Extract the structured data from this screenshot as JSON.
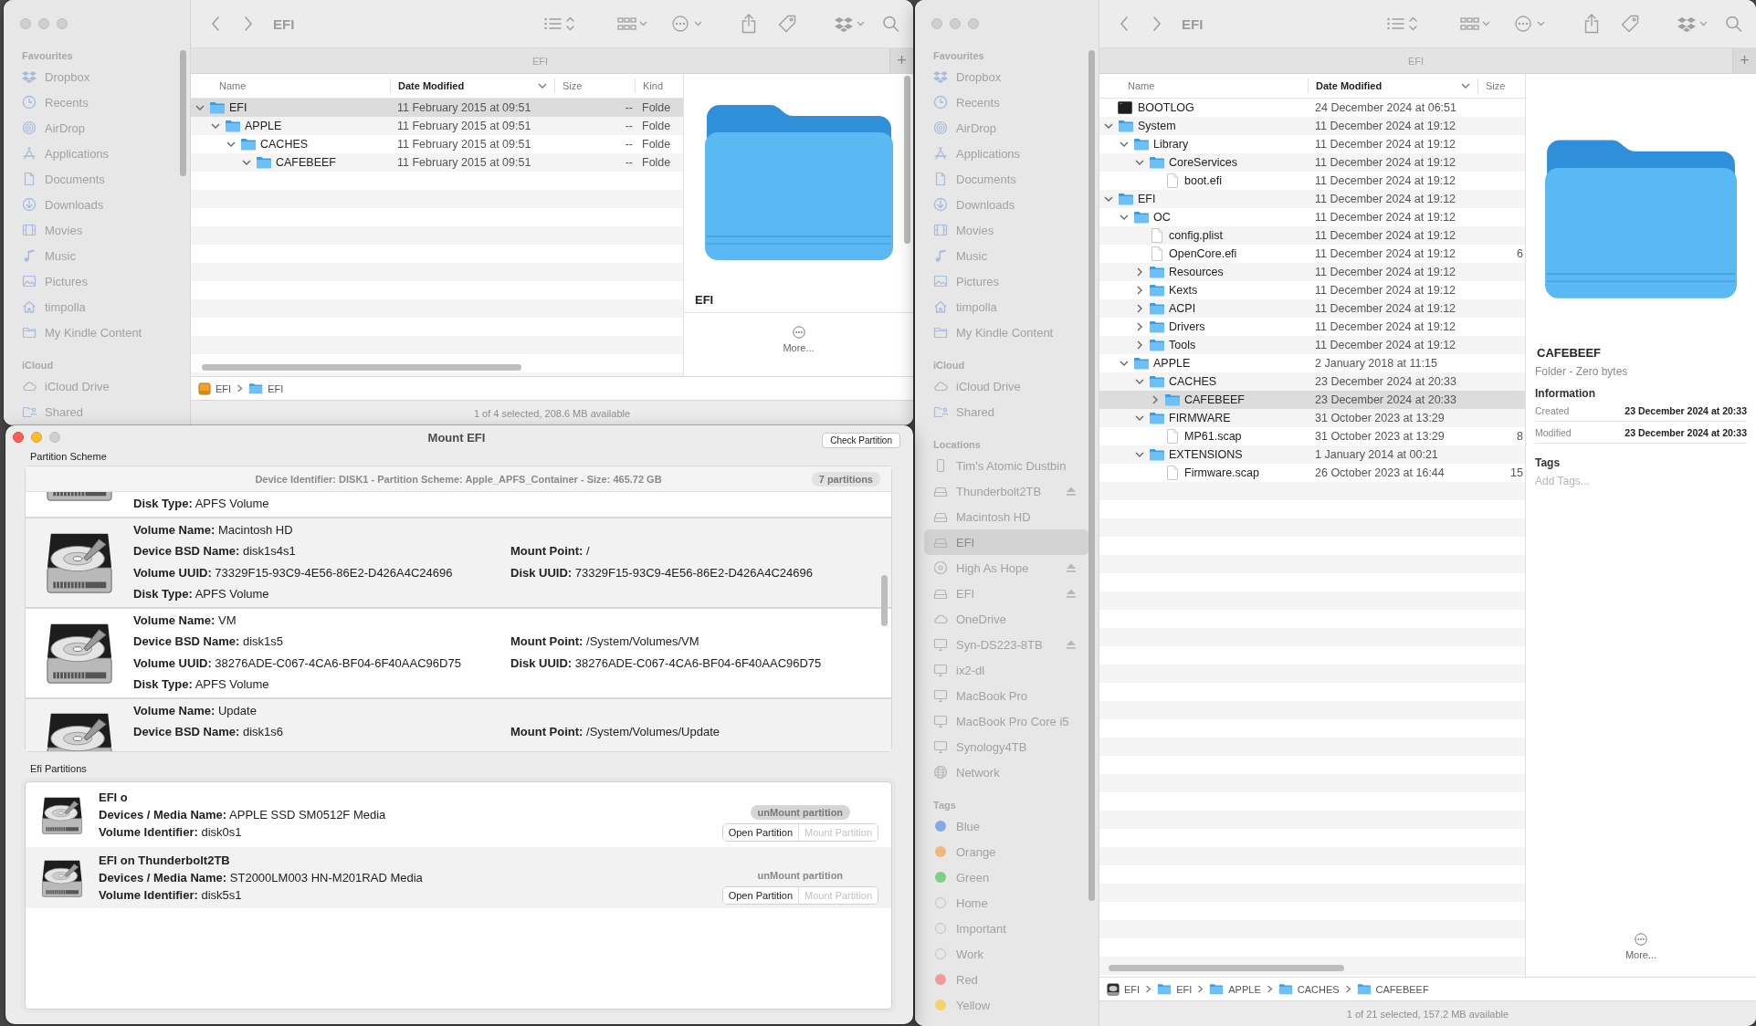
{
  "finder_windows": [
    {
      "active": false,
      "title": "EFI",
      "tab": "EFI",
      "new_tab": "+",
      "sidebar": [
        {
          "heading": "Favourites",
          "items": [
            {
              "label": "Dropbox",
              "kind": "dropbox",
              "selected": false
            },
            {
              "label": "Recents",
              "kind": "clock",
              "selected": false
            },
            {
              "label": "AirDrop",
              "kind": "airdrop",
              "selected": false
            },
            {
              "label": "Applications",
              "kind": "apps",
              "selected": false
            },
            {
              "label": "Documents",
              "kind": "document",
              "selected": false
            },
            {
              "label": "Downloads",
              "kind": "download",
              "selected": false
            },
            {
              "label": "Movies",
              "kind": "film",
              "selected": false
            },
            {
              "label": "Music",
              "kind": "music",
              "selected": false
            },
            {
              "label": "Pictures",
              "kind": "picture",
              "selected": false
            },
            {
              "label": "timpolla",
              "kind": "home",
              "selected": false
            },
            {
              "label": "My Kindle Content",
              "kind": "folder",
              "selected": false
            }
          ]
        },
        {
          "heading": "iCloud",
          "items": [
            {
              "label": "iCloud Drive",
              "kind": "cloud",
              "selected": false
            },
            {
              "label": "Shared",
              "kind": "shared",
              "selected": false
            }
          ]
        }
      ],
      "columns": [
        {
          "label": "Name",
          "sorted": false
        },
        {
          "label": "Date Modified",
          "sorted": true
        },
        {
          "label": "Size",
          "sorted": false
        },
        {
          "label": "Kind",
          "sorted": false
        }
      ],
      "rows": [
        {
          "name": "EFI",
          "kind": "folder",
          "expanded": true,
          "selected": true,
          "date_modified": "11 February 2015 at 09:51",
          "size": "--",
          "kind_label": "Folde",
          "children": [
            {
              "name": "APPLE",
              "kind": "folder",
              "expanded": true,
              "selected": false,
              "date_modified": "11 February 2015 at 09:51",
              "size": "--",
              "kind_label": "Folde",
              "children": [
                {
                  "name": "CACHES",
                  "kind": "folder",
                  "expanded": true,
                  "selected": false,
                  "date_modified": "11 February 2015 at 09:51",
                  "size": "--",
                  "kind_label": "Folde",
                  "children": [
                    {
                      "name": "CAFEBEEF",
                      "kind": "folder",
                      "expanded": true,
                      "selected": false,
                      "date_modified": "11 February 2015 at 09:51",
                      "size": "--",
                      "kind_label": "Folde"
                    }
                  ]
                }
              ]
            }
          ]
        }
      ],
      "path": [
        {
          "label": "EFI",
          "kind": "external_disk"
        },
        {
          "label": "EFI",
          "kind": "folder"
        }
      ],
      "status": "1 of 4 selected, 208.6 MB available",
      "preview": {
        "name": "EFI",
        "more": "More..."
      }
    },
    {
      "active": false,
      "title": "EFI",
      "tab": "EFI",
      "new_tab": "+",
      "sidebar": [
        {
          "heading": "Favourites",
          "items": [
            {
              "label": "Dropbox",
              "kind": "dropbox",
              "selected": false
            },
            {
              "label": "Recents",
              "kind": "clock",
              "selected": false
            },
            {
              "label": "AirDrop",
              "kind": "airdrop",
              "selected": false
            },
            {
              "label": "Applications",
              "kind": "apps",
              "selected": false
            },
            {
              "label": "Documents",
              "kind": "document",
              "selected": false
            },
            {
              "label": "Downloads",
              "kind": "download",
              "selected": false
            },
            {
              "label": "Movies",
              "kind": "film",
              "selected": false
            },
            {
              "label": "Music",
              "kind": "music",
              "selected": false
            },
            {
              "label": "Pictures",
              "kind": "picture",
              "selected": false
            },
            {
              "label": "timpolla",
              "kind": "home",
              "selected": false
            },
            {
              "label": "My Kindle Content",
              "kind": "folder",
              "selected": false
            }
          ]
        },
        {
          "heading": "iCloud",
          "items": [
            {
              "label": "iCloud Drive",
              "kind": "cloud",
              "selected": false
            },
            {
              "label": "Shared",
              "kind": "shared",
              "selected": false
            }
          ]
        },
        {
          "heading": "Locations",
          "items": [
            {
              "label": "Tim's Atomic Dustbin",
              "kind": "phone",
              "selected": false,
              "eject": false
            },
            {
              "label": "Thunderbolt2TB",
              "kind": "drive",
              "selected": false,
              "eject": true
            },
            {
              "label": "Macintosh HD",
              "kind": "drive",
              "selected": false,
              "eject": false
            },
            {
              "label": "EFI",
              "kind": "drive",
              "selected": true,
              "eject": false
            },
            {
              "label": "High As Hope",
              "kind": "disc",
              "selected": false,
              "eject": true
            },
            {
              "label": "EFI",
              "kind": "drive",
              "selected": false,
              "eject": true
            },
            {
              "label": "OneDrive",
              "kind": "cloud",
              "selected": false,
              "eject": false
            },
            {
              "label": "Syn-DS223-8TB",
              "kind": "monitor",
              "selected": false,
              "eject": true
            },
            {
              "label": "ix2-dl",
              "kind": "monitor",
              "selected": false,
              "eject": false
            },
            {
              "label": "MacBook Pro",
              "kind": "monitor",
              "selected": false,
              "eject": false
            },
            {
              "label": "MacBook Pro Core i5",
              "kind": "monitor",
              "selected": false,
              "eject": false
            },
            {
              "label": "Synology4TB",
              "kind": "monitor",
              "selected": false,
              "eject": false
            },
            {
              "label": "Network",
              "kind": "globe",
              "selected": false,
              "eject": false
            }
          ]
        },
        {
          "heading": "Tags",
          "items": [
            {
              "label": "Blue",
              "kind": "tag",
              "selected": false,
              "color": "#82aae6"
            },
            {
              "label": "Orange",
              "kind": "tag",
              "selected": false,
              "color": "#f0b77a"
            },
            {
              "label": "Green",
              "kind": "tag",
              "selected": false,
              "color": "#7ccf86"
            },
            {
              "label": "Home",
              "kind": "tag",
              "selected": false
            },
            {
              "label": "Important",
              "kind": "tag",
              "selected": false
            },
            {
              "label": "Work",
              "kind": "tag",
              "selected": false
            },
            {
              "label": "Red",
              "kind": "tag",
              "selected": false,
              "color": "#f09a9a"
            },
            {
              "label": "Yellow",
              "kind": "tag",
              "selected": false,
              "color": "#f3d36a"
            }
          ]
        }
      ],
      "columns": [
        {
          "label": "Name",
          "sorted": false
        },
        {
          "label": "Date Modified",
          "sorted": true
        },
        {
          "label": "Size",
          "sorted": false
        }
      ],
      "rows": [
        {
          "name": "BOOTLOG",
          "kind": "log",
          "selected": false,
          "date_modified": "24 December 2024 at 06:51"
        },
        {
          "name": "System",
          "kind": "folder",
          "expanded": true,
          "selected": false,
          "date_modified": "11 December 2024 at 19:12",
          "children": [
            {
              "name": "Library",
              "kind": "folder",
              "expanded": true,
              "selected": false,
              "date_modified": "11 December 2024 at 19:12",
              "children": [
                {
                  "name": "CoreServices",
                  "kind": "folder",
                  "expanded": true,
                  "selected": false,
                  "date_modified": "11 December 2024 at 19:12",
                  "children": [
                    {
                      "name": "boot.efi",
                      "kind": "file",
                      "selected": false,
                      "date_modified": "11 December 2024 at 19:12"
                    }
                  ]
                }
              ]
            }
          ]
        },
        {
          "name": "EFI",
          "kind": "folder",
          "expanded": true,
          "selected": false,
          "date_modified": "11 December 2024 at 19:12",
          "children": [
            {
              "name": "OC",
              "kind": "folder",
              "expanded": true,
              "selected": false,
              "date_modified": "11 December 2024 at 19:12",
              "children": [
                {
                  "name": "config.plist",
                  "kind": "file",
                  "selected": false,
                  "date_modified": "11 December 2024 at 19:12"
                },
                {
                  "name": "OpenCore.efi",
                  "kind": "file",
                  "selected": false,
                  "date_modified": "11 December 2024 at 19:12",
                  "size": "6"
                },
                {
                  "name": "Resources",
                  "kind": "folder",
                  "expanded": false,
                  "selected": false,
                  "date_modified": "11 December 2024 at 19:12"
                },
                {
                  "name": "Kexts",
                  "kind": "folder",
                  "expanded": false,
                  "selected": false,
                  "date_modified": "11 December 2024 at 19:12"
                },
                {
                  "name": "ACPI",
                  "kind": "folder",
                  "expanded": false,
                  "selected": false,
                  "date_modified": "11 December 2024 at 19:12"
                },
                {
                  "name": "Drivers",
                  "kind": "folder",
                  "expanded": false,
                  "selected": false,
                  "date_modified": "11 December 2024 at 19:12"
                },
                {
                  "name": "Tools",
                  "kind": "folder",
                  "expanded": false,
                  "selected": false,
                  "date_modified": "11 December 2024 at 19:12"
                }
              ]
            },
            {
              "name": "APPLE",
              "kind": "folder",
              "expanded": true,
              "selected": false,
              "date_modified": "2 January 2018 at 11:15",
              "children": [
                {
                  "name": "CACHES",
                  "kind": "folder",
                  "expanded": true,
                  "selected": false,
                  "date_modified": "23 December 2024 at 20:33",
                  "children": [
                    {
                      "name": "CAFEBEEF",
                      "kind": "folder",
                      "expanded": false,
                      "selected": true,
                      "date_modified": "23 December 2024 at 20:33"
                    }
                  ]
                },
                {
                  "name": "FIRMWARE",
                  "kind": "folder",
                  "expanded": true,
                  "selected": false,
                  "date_modified": "31 October 2023 at 13:29",
                  "children": [
                    {
                      "name": "MP61.scap",
                      "kind": "file",
                      "selected": false,
                      "date_modified": "31 October 2023 at 13:29",
                      "size": "8"
                    }
                  ]
                },
                {
                  "name": "EXTENSIONS",
                  "kind": "folder",
                  "expanded": true,
                  "selected": false,
                  "date_modified": "1 January 2014 at 00:21",
                  "children": [
                    {
                      "name": "Firmware.scap",
                      "kind": "file",
                      "selected": false,
                      "date_modified": "26 October 2023 at 16:44",
                      "size": "15"
                    }
                  ]
                }
              ]
            }
          ]
        }
      ],
      "path": [
        {
          "label": "EFI",
          "kind": "disk"
        },
        {
          "label": "EFI",
          "kind": "folder"
        },
        {
          "label": "APPLE",
          "kind": "folder"
        },
        {
          "label": "CACHES",
          "kind": "folder"
        },
        {
          "label": "CAFEBEEF",
          "kind": "folder"
        }
      ],
      "status": "1 of 21 selected, 157.2 MB available",
      "preview": {
        "name": "CAFEBEEF",
        "subtitle": "Folder - Zero bytes",
        "info_heading": "Information",
        "info": [
          {
            "label": "Created",
            "value": "23 December 2024 at 20:33"
          },
          {
            "label": "Modified",
            "value": "23 December 2024 at 20:33"
          }
        ],
        "tags_heading": "Tags",
        "tags_placeholder": "Add Tags...",
        "more": "More..."
      }
    }
  ],
  "mount_window": {
    "active": true,
    "title": "Mount EFI",
    "check_button": "Check Partition",
    "scheme_label": "Partition Scheme",
    "device_header": "Device Identifier: DISK1 - Partition Scheme: Apple_APFS_Container - Size: 465.72 GB",
    "partition_count": "7 partitions",
    "volumes": [
      {
        "lines": [
          [
            "**Disk Type:** APFS Volume"
          ]
        ]
      },
      {
        "lines": [
          [
            "**Volume Name:** Macintosh HD"
          ],
          [
            "**Device BSD Name:** disk1s4s1",
            "**Mount Point:** /"
          ],
          [
            "**Volume UUID:** 73329F15-93C9-4E56-86E2-D426A4C24696",
            "**Disk UUID:** 73329F15-93C9-4E56-86E2-D426A4C24696"
          ],
          [
            "**Disk Type:** APFS Volume"
          ]
        ]
      },
      {
        "lines": [
          [
            "**Volume Name:** VM"
          ],
          [
            "**Device BSD Name:** disk1s5",
            "**Mount Point:** /System/Volumes/VM"
          ],
          [
            "**Volume UUID:** 38276ADE-C067-4CA6-BF04-6F40AAC96D75",
            "**Disk UUID:** 38276ADE-C067-4CA6-BF04-6F40AAC96D75"
          ],
          [
            "**Disk Type:** APFS Volume"
          ]
        ]
      },
      {
        "lines": [
          [
            "**Volume Name:** Update"
          ],
          [
            "**Device BSD Name:** disk1s6",
            "**Mount Point:** /System/Volumes/Update"
          ]
        ]
      }
    ],
    "efi_label": "Efi Partitions",
    "efi_partitions": [
      {
        "name": "EFI o",
        "lines": [
          "**Devices / Media Name:** APPLE SSD SM0512F Media",
          "**Volume Identifier:** disk0s1"
        ],
        "unmount": "unMount partition",
        "unmount_highlighted": true,
        "open": "Open Partition",
        "mount": "Mount Partition",
        "mount_disabled": true
      },
      {
        "name": "EFI on Thunderbolt2TB",
        "lines": [
          "**Devices / Media Name:** ST2000LM003 HN-M201RAD Media",
          "**Volume Identifier:** disk5s1"
        ],
        "unmount": "unMount partition",
        "unmount_highlighted": false,
        "open": "Open Partition",
        "mount": "Mount Partition",
        "mount_disabled": true
      }
    ]
  }
}
